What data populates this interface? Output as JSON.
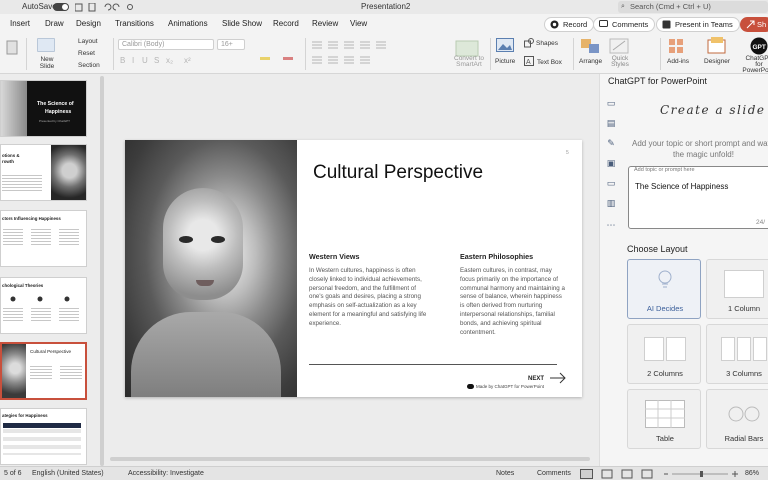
{
  "titlebar": {
    "autosave_label": "AutoSave",
    "doc_title": "Presentation2",
    "search_placeholder": "Search (Cmd + Ctrl + U)"
  },
  "tabs": [
    "Insert",
    "Draw",
    "Design",
    "Transitions",
    "Animations",
    "Slide Show",
    "Record",
    "Review",
    "View"
  ],
  "tab_buttons": {
    "record": "Record",
    "comments": "Comments",
    "teams": "Present in Teams",
    "share": "Sh"
  },
  "ribbon": {
    "new_slide": "New Slide",
    "layout": "Layout",
    "reset": "Reset",
    "section": "Section",
    "font_name": "Calibri (Body)",
    "font_size": "16+",
    "convert_smartart": "Convert to SmartArt",
    "picture": "Picture",
    "shapes": "Shapes",
    "text_box": "Text Box",
    "arrange": "Arrange",
    "quick_styles": "Quick Styles",
    "add_ins": "Add-ins",
    "designer": "Designer",
    "chatgpt": "ChatGPT for PowerPoint"
  },
  "thumbnails": [
    {
      "num": "1",
      "title_line1": "The Science of",
      "title_line2": "Happiness",
      "sub": "Presented by ChatGPT"
    },
    {
      "num": "2",
      "title": "otions &",
      "title2": "rowth"
    },
    {
      "num": "3",
      "title": "ctors Influencing Happiness"
    },
    {
      "num": "4",
      "title": "chological Theories"
    },
    {
      "num": "5",
      "title": "Cultural Perspective"
    },
    {
      "num": "6",
      "title": "ategies for Happiness"
    }
  ],
  "slide": {
    "title": "Cultural Perspective",
    "left_heading": "Western Views",
    "left_body": "In Western cultures, happiness is often closely linked to individual achievements, personal freedom, and the fulfillment of one's goals and desires, placing a strong emphasis on self-actualization as a key element for a meaningful and satisfying life experience.",
    "right_heading": "Eastern Philosophies",
    "right_body": "Eastern cultures, in contrast, may focus primarily on the importance of communal harmony and maintaining a sense of balance, wherein happiness is often derived from nurturing interpersonal relationships, familial bonds, and achieving spiritual contentment.",
    "next_label": "NEXT",
    "made_by": "Made by ChatGPT for PowerPoint",
    "page_num": "5"
  },
  "panel": {
    "title": "ChatGPT for PowerPoint",
    "heading": "Create a slide",
    "help_line1": "Add your topic or short prompt and watch",
    "help_line2": "the magic unfold!",
    "input_label": "Add topic or prompt here",
    "input_value": "The Science of Happiness",
    "char_count": "24/",
    "layout_heading": "Choose Layout",
    "layouts": [
      "AI Decides",
      "1 Column",
      "2 Columns",
      "3 Columns",
      "Table",
      "Radial Bars"
    ]
  },
  "statusbar": {
    "slide_count": "5 of 6",
    "language": "English (United States)",
    "accessibility": "Accessibility: Investigate",
    "notes": "Notes",
    "comments": "Comments",
    "zoom": "86%"
  }
}
